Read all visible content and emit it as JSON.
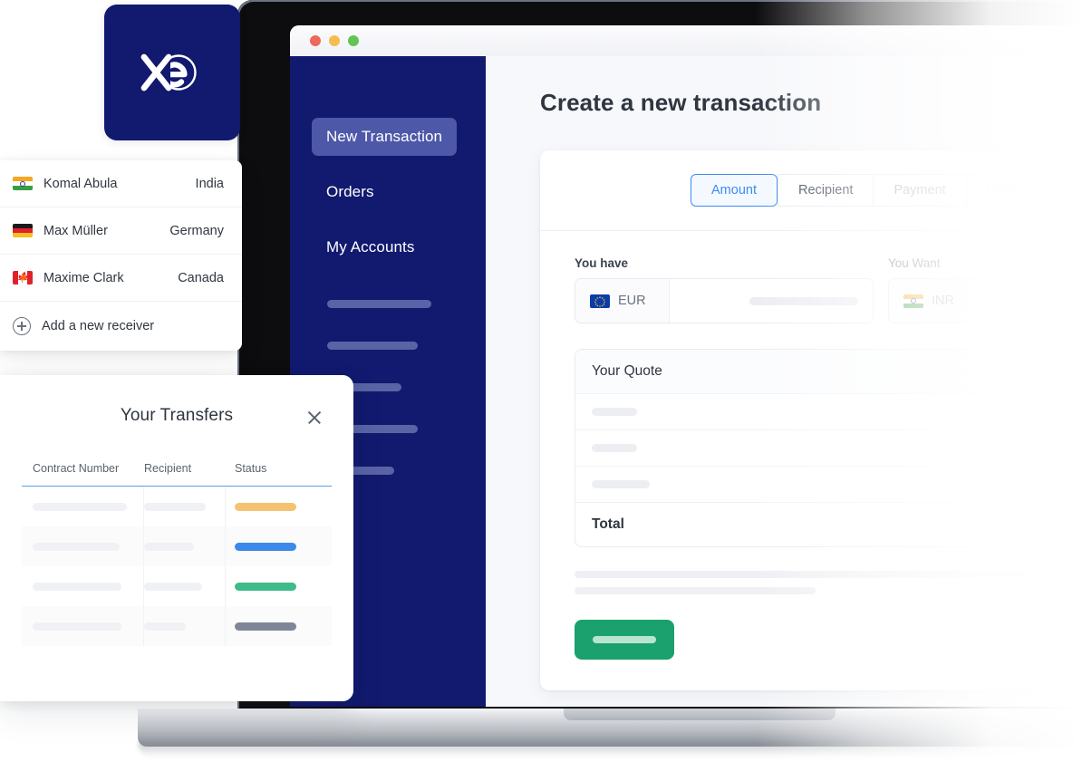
{
  "brand": {
    "logo_text": "xe",
    "navy": "#111a6e"
  },
  "browser": {
    "traffic_lights": [
      "close-red",
      "minimize-amber",
      "maximize-green"
    ]
  },
  "sidebar": {
    "items": [
      {
        "label": "New Transaction",
        "active": true
      },
      {
        "label": "Orders",
        "active": false
      },
      {
        "label": "My Accounts",
        "active": false
      }
    ],
    "skeleton_bars": [
      115,
      100,
      82,
      100,
      74
    ]
  },
  "main": {
    "page_title": "Create a new transaction",
    "tabs": [
      {
        "label": "Amount",
        "state": "active"
      },
      {
        "label": "Recipient",
        "state": "default"
      },
      {
        "label": "Payment",
        "state": "disabled"
      },
      {
        "label": "Confirm",
        "state": "disabled-faded"
      }
    ],
    "you_have": {
      "label": "You have",
      "currency_code": "EUR",
      "flag": "eu-flag-icon",
      "amount": ""
    },
    "you_want": {
      "label": "You Want",
      "currency_code": "INR",
      "flag": "india-flag-icon",
      "amount": ""
    },
    "quote": {
      "header": "Your Quote",
      "rows": [
        118,
        118,
        145
      ],
      "total_label": "Total"
    },
    "footer_lines": [
      520,
      262
    ],
    "cta": {
      "label": ""
    }
  },
  "recipients": {
    "rows": [
      {
        "flag": "india-flag-icon",
        "name": "Komal Abula",
        "country": "India"
      },
      {
        "flag": "germany-flag-icon",
        "name": "Max Müller",
        "country": "Germany"
      },
      {
        "flag": "canada-flag-icon",
        "name": "Maxime Clark",
        "country": "Canada"
      }
    ],
    "add_label": "Add a new receiver",
    "add_icon": "plus-circle-icon"
  },
  "transfers": {
    "title": "Your Transfers",
    "close_icon": "close-icon",
    "columns": [
      "Contract Number",
      "Recipient",
      "Status"
    ],
    "accent": "#5b9bf0",
    "rows": [
      {
        "contract_w": 104,
        "recipient_w": 68,
        "status_color": "#f5c271",
        "status_w": 68,
        "alt": false
      },
      {
        "contract_w": 96,
        "recipient_w": 55,
        "status_color": "#3b8aea",
        "status_w": 68,
        "alt": true
      },
      {
        "contract_w": 98,
        "recipient_w": 64,
        "status_color": "#3fbb8a",
        "status_w": 68,
        "alt": false
      },
      {
        "contract_w": 98,
        "recipient_w": 46,
        "status_color": "#808697",
        "status_w": 68,
        "alt": true
      }
    ]
  },
  "colors": {
    "navy": "#111a6e",
    "navy_active": "#4d58a8",
    "green_cta": "#1aa16d",
    "tab_blue": "#3d8bf2",
    "status_pending": "#f5c271",
    "status_progress": "#3b8aea",
    "status_complete": "#3fbb8a",
    "status_cancelled": "#808697"
  }
}
